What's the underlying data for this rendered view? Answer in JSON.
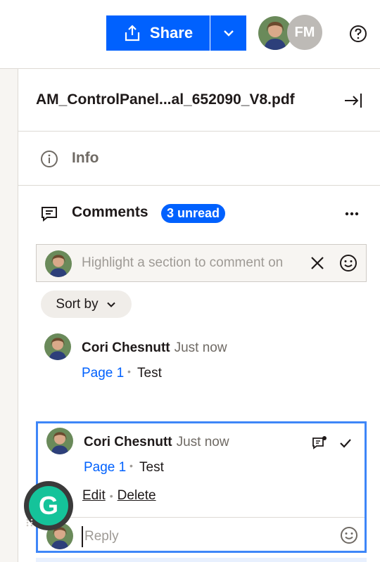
{
  "topbar": {
    "share_label": "Share",
    "collaborator_initials": "FM"
  },
  "file": {
    "title": "AM_ControlPanel...al_652090_V8.pdf"
  },
  "info": {
    "label": "Info"
  },
  "comments": {
    "label": "Comments",
    "unread_badge": "3 unread",
    "highlight_placeholder": "Highlight a section to comment on",
    "sort_label": "Sort by",
    "items": [
      {
        "author": "Cori Chesnutt",
        "time": "Just now",
        "page": "Page 1",
        "separator": "•",
        "text": "Test"
      },
      {
        "author": "Cori Chesnutt",
        "time": "Just now",
        "page": "Page 1",
        "separator": "•",
        "text": "Test",
        "edit_label": "Edit",
        "delete_label": "Delete",
        "reply_placeholder": "Reply"
      }
    ]
  },
  "grammarly": {
    "letter": "G"
  },
  "colors": {
    "accent": "#0061fe",
    "selected_border": "#3e86f8",
    "grammarly": "#15c39a"
  },
  "icons": [
    "upload-icon",
    "chevron-down-icon",
    "help-icon",
    "collapse-panel-icon",
    "info-icon",
    "comment-icon",
    "more-icon",
    "close-icon",
    "emoji-icon",
    "reply-thread-icon",
    "check-icon"
  ]
}
